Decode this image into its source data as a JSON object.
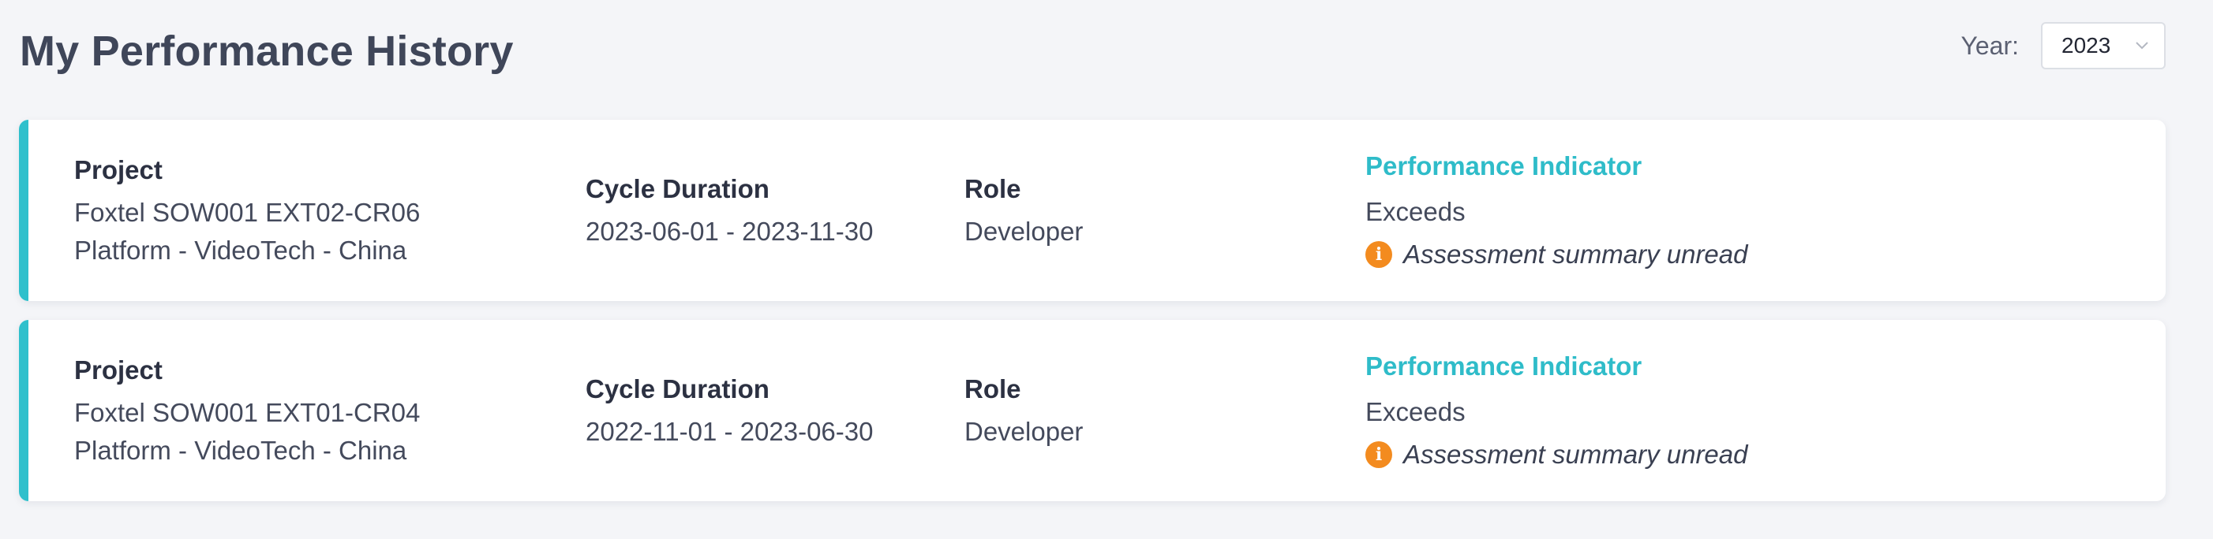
{
  "header": {
    "title": "My Performance History"
  },
  "filter": {
    "year_label": "Year:",
    "year_value": "2023"
  },
  "colors": {
    "accent": "#2fc0cc",
    "performance_label": "#2fbcc9",
    "notice_icon": "#f38b1f",
    "background": "#f4f5f8"
  },
  "icons": {
    "dropdown": "chevron-down-icon",
    "notice": "info-icon"
  },
  "records": [
    {
      "project_label": "Project",
      "project_name": "Foxtel SOW001 EXT02-CR06",
      "project_group": "Platform - VideoTech - China",
      "cycle_label": "Cycle Duration",
      "cycle_value": "2023-06-01 - 2023-11-30",
      "role_label": "Role",
      "role_value": "Developer",
      "performance_label": "Performance Indicator",
      "performance_value": "Exceeds",
      "notice_icon_glyph": "i",
      "notice_text": "Assessment summary unread"
    },
    {
      "project_label": "Project",
      "project_name": "Foxtel SOW001 EXT01-CR04",
      "project_group": "Platform - VideoTech - China",
      "cycle_label": "Cycle Duration",
      "cycle_value": "2022-11-01 - 2023-06-30",
      "role_label": "Role",
      "role_value": "Developer",
      "performance_label": "Performance Indicator",
      "performance_value": "Exceeds",
      "notice_icon_glyph": "i",
      "notice_text": "Assessment summary unread"
    }
  ]
}
